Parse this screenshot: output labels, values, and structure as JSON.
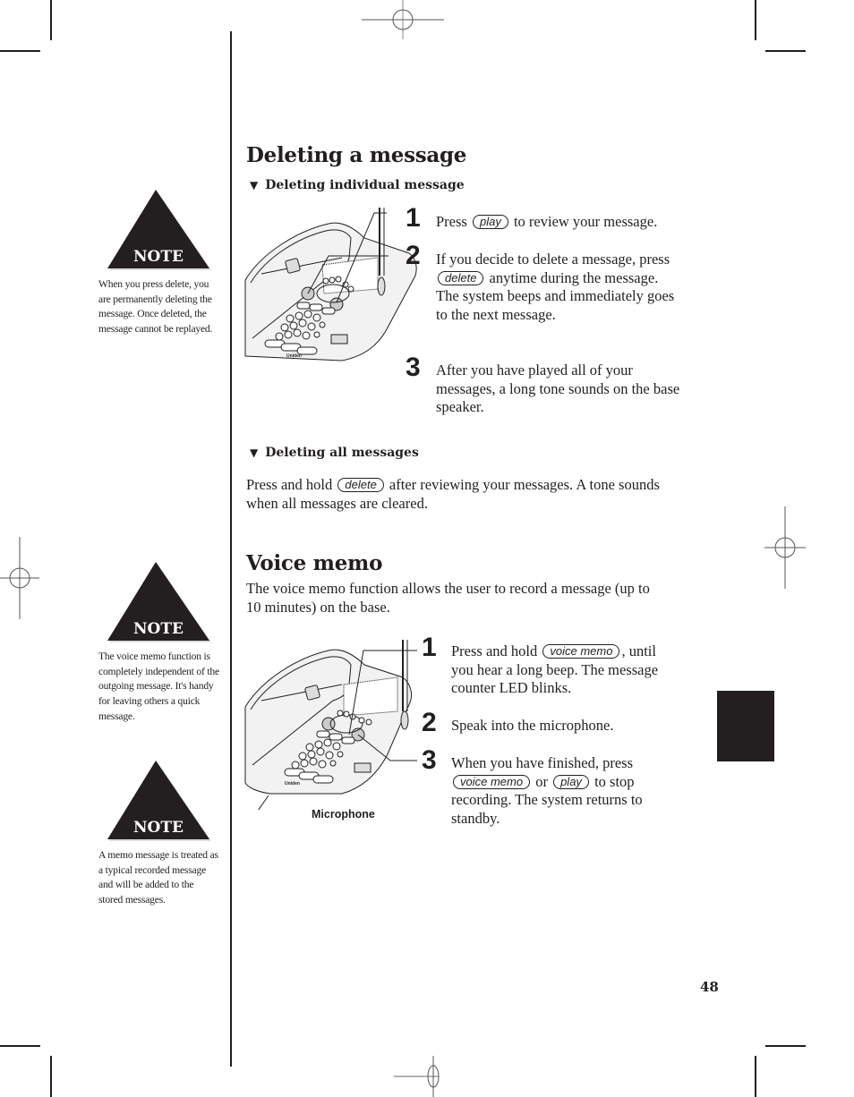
{
  "notes": [
    {
      "title": "NOTE",
      "text": "When you press delete, you are permanently deleting the message. Once deleted, the message cannot be replayed."
    },
    {
      "title": "NOTE",
      "text": "The voice memo function is completely  independent of the outgoing message. It's handy for leaving others a quick message."
    },
    {
      "title": "NOTE",
      "text": "A memo message is treated as a typical recorded message and will be added to the stored messages."
    }
  ],
  "deleting": {
    "title": "Deleting a message",
    "individual": {
      "heading": "Deleting individual message",
      "steps": [
        {
          "num": "1",
          "pre": "Press",
          "key": "play",
          "post": "to review your message."
        },
        {
          "num": "2",
          "pre": "If you decide to delete a message, press",
          "key": "delete",
          "post": "anytime during the message. The system beeps and immediately goes to the next message."
        },
        {
          "num": "3",
          "text": "After you have played all of your messages, a long tone sounds on the base speaker."
        }
      ]
    },
    "all": {
      "heading": "Deleting all messages",
      "pre": "Press and hold",
      "key": "delete",
      "post": "after reviewing your messages. A tone sounds when all messages are cleared."
    }
  },
  "voice_memo": {
    "title": "Voice memo",
    "intro": "The voice memo function allows the user to record a message (up to 10 minutes) on the base.",
    "steps": [
      {
        "num": "1",
        "pre": "Press and hold",
        "key": "voice memo",
        "post": ", until you hear a long beep. The message counter LED blinks."
      },
      {
        "num": "2",
        "text": "Speak into the microphone."
      },
      {
        "num": "3",
        "pre": "When you have finished, press",
        "key": "voice memo",
        "mid": "or",
        "key2": "play",
        "post": "to stop recording. The system returns to standby."
      }
    ],
    "microphone_label": "Microphone"
  },
  "phone_brand": "Uniden",
  "page_number": "48"
}
